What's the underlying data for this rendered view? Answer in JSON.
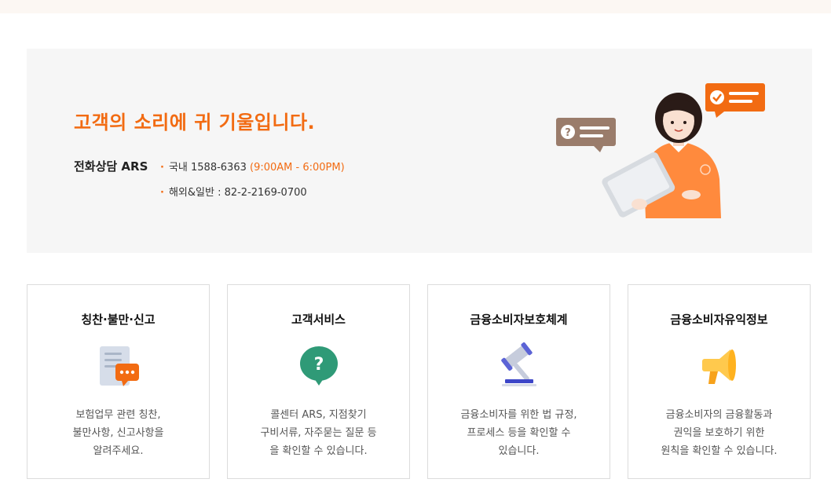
{
  "hero": {
    "title": "고객의 소리에 귀 기울입니다.",
    "ars_label": "전화상담 ARS",
    "domestic": "국내 1588-6363",
    "hours": "(9:00AM - 6:00PM)",
    "overseas": "해외&일반 : 82-2-2169-0700"
  },
  "cards": [
    {
      "title": "칭찬·불만·신고",
      "icon": "document-chat-icon",
      "desc": [
        "보험업무 관련 칭찬,",
        "불만사항, 신고사항을",
        "알려주세요."
      ]
    },
    {
      "title": "고객서비스",
      "icon": "question-bubble-icon",
      "desc": [
        "콜센터 ARS, 지점찾기",
        "구비서류, 자주묻는 질문 등",
        "을 확인할 수 있습니다."
      ]
    },
    {
      "title": "금융소비자보호체계",
      "icon": "gavel-icon",
      "desc": [
        "금융소비자를 위한 법 규정,",
        "프로세스 등을 확인할 수",
        "있습니다."
      ]
    },
    {
      "title": "금융소비자유익정보",
      "icon": "megaphone-icon",
      "desc": [
        "금융소비자의 금융활동과",
        "권익을 보호하기 위한",
        "원칙을 확인할 수 있습니다."
      ]
    }
  ],
  "colors": {
    "accent": "#f26b12",
    "hero_bg": "#f6f6f6",
    "card_border": "#dcdcdc"
  }
}
